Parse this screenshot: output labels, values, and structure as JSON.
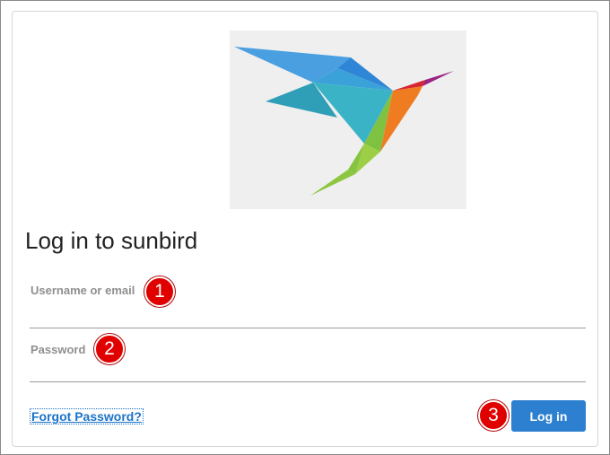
{
  "logo": {
    "icon": "origami-hummingbird-logo"
  },
  "heading": "Log in to sunbird",
  "form": {
    "username": {
      "label": "Username or email",
      "value": "",
      "placeholder": ""
    },
    "password": {
      "label": "Password",
      "value": "",
      "placeholder": ""
    },
    "forgot_password": "Forgot Password?",
    "submit_label": "Log in"
  },
  "callouts": [
    "1",
    "2",
    "3"
  ],
  "colors": {
    "accent": "#2d7fd0",
    "link": "#1a73c8",
    "callout": "#e00000",
    "logo_background": "#efefef"
  }
}
